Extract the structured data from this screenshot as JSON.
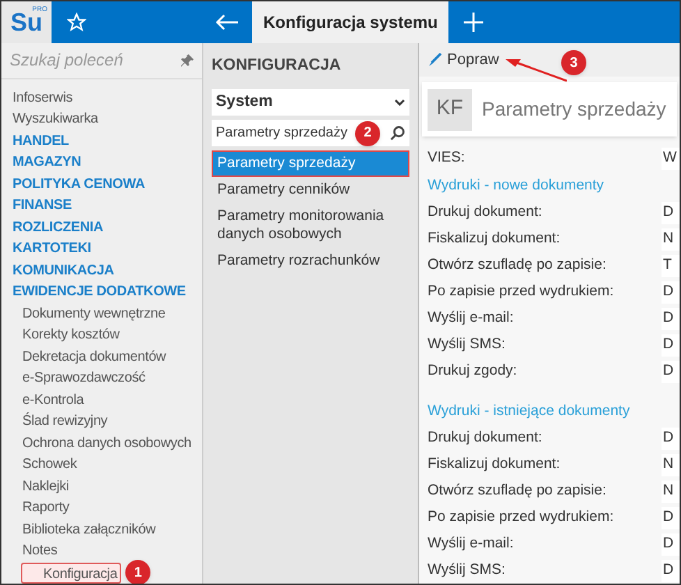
{
  "logo": {
    "text": "Su",
    "badge": "PRO"
  },
  "tabs": [
    {
      "label": "Konfiguracja systemu",
      "selected": true
    }
  ],
  "sidebar": {
    "search": {
      "placeholder": "Szukaj poleceń"
    },
    "items": [
      {
        "label": "Infoserwis",
        "kind": "item",
        "selected": false
      },
      {
        "label": "Wyszukiwarka",
        "kind": "item",
        "selected": false
      },
      {
        "label": "HANDEL",
        "kind": "section",
        "selected": false
      },
      {
        "label": "MAGAZYN",
        "kind": "section",
        "selected": false
      },
      {
        "label": "POLITYKA CENOWA",
        "kind": "section",
        "selected": false
      },
      {
        "label": "FINANSE",
        "kind": "section",
        "selected": false
      },
      {
        "label": "ROZLICZENIA",
        "kind": "section",
        "selected": false
      },
      {
        "label": "KARTOTEKI",
        "kind": "section",
        "selected": false
      },
      {
        "label": "KOMUNIKACJA",
        "kind": "section",
        "selected": false
      },
      {
        "label": "EWIDENCJE DODATKOWE",
        "kind": "section",
        "selected": false,
        "children": [
          {
            "label": "Dokumenty wewnętrzne",
            "selected": false
          },
          {
            "label": "Korekty kosztów",
            "selected": false
          },
          {
            "label": "Dekretacja dokumentów",
            "selected": false
          },
          {
            "label": "e-Sprawozdawczość",
            "selected": false
          },
          {
            "label": "e-Kontrola",
            "selected": false
          },
          {
            "label": "Ślad rewizyjny",
            "selected": false
          },
          {
            "label": "Ochrona danych osobowych",
            "selected": false
          },
          {
            "label": "Schowek",
            "selected": false
          },
          {
            "label": "Naklejki",
            "selected": false
          },
          {
            "label": "Raporty",
            "selected": false
          },
          {
            "label": "Biblioteka załączników",
            "selected": false
          },
          {
            "label": "Notes",
            "selected": false
          },
          {
            "label": "Konfiguracja",
            "selected": true,
            "annotation": "1"
          }
        ]
      }
    ]
  },
  "config_panel": {
    "title": "KONFIGURACJA",
    "dropdown": "System",
    "search": {
      "value": "Parametry sprzedaży",
      "annotation": "2"
    },
    "items": [
      {
        "label": "Parametry sprzedaży",
        "selected": true
      },
      {
        "label": "Parametry cenników",
        "selected": false
      },
      {
        "label": "Parametry monitorowania danych osobowych",
        "selected": false
      },
      {
        "label": "Parametry rozrachunków",
        "selected": false
      }
    ]
  },
  "toolbar": {
    "button": "Popraw",
    "annotation": "3"
  },
  "details": {
    "badge": "KF",
    "title": "Parametry sprzedaży",
    "rows": [
      {
        "kind": "field",
        "label": "VIES:",
        "value": "W"
      },
      {
        "kind": "heading",
        "label": "Wydruki - nowe dokumenty"
      },
      {
        "kind": "field",
        "label": "Drukuj dokument:",
        "value": "D"
      },
      {
        "kind": "field",
        "label": "Fiskalizuj dokument:",
        "value": "N"
      },
      {
        "kind": "field",
        "label": "Otwórz szufladę po zapisie:",
        "value": "T"
      },
      {
        "kind": "field",
        "label": "Po zapisie przed wydrukiem:",
        "value": "D"
      },
      {
        "kind": "field",
        "label": "Wyślij e-mail:",
        "value": "D"
      },
      {
        "kind": "field",
        "label": "Wyślij SMS:",
        "value": "D"
      },
      {
        "kind": "field",
        "label": "Drukuj zgody:",
        "value": "D"
      },
      {
        "kind": "heading",
        "label": "Wydruki - istniejące dokumenty"
      },
      {
        "kind": "field",
        "label": "Drukuj dokument:",
        "value": "D"
      },
      {
        "kind": "field",
        "label": "Fiskalizuj dokument:",
        "value": "N"
      },
      {
        "kind": "field",
        "label": "Otwórz szufladę po zapisie:",
        "value": "N"
      },
      {
        "kind": "field",
        "label": "Po zapisie przed wydrukiem:",
        "value": "D"
      },
      {
        "kind": "field",
        "label": "Wyślij e-mail:",
        "value": "D"
      },
      {
        "kind": "field",
        "label": "Wyślij SMS:",
        "value": "D"
      }
    ]
  }
}
